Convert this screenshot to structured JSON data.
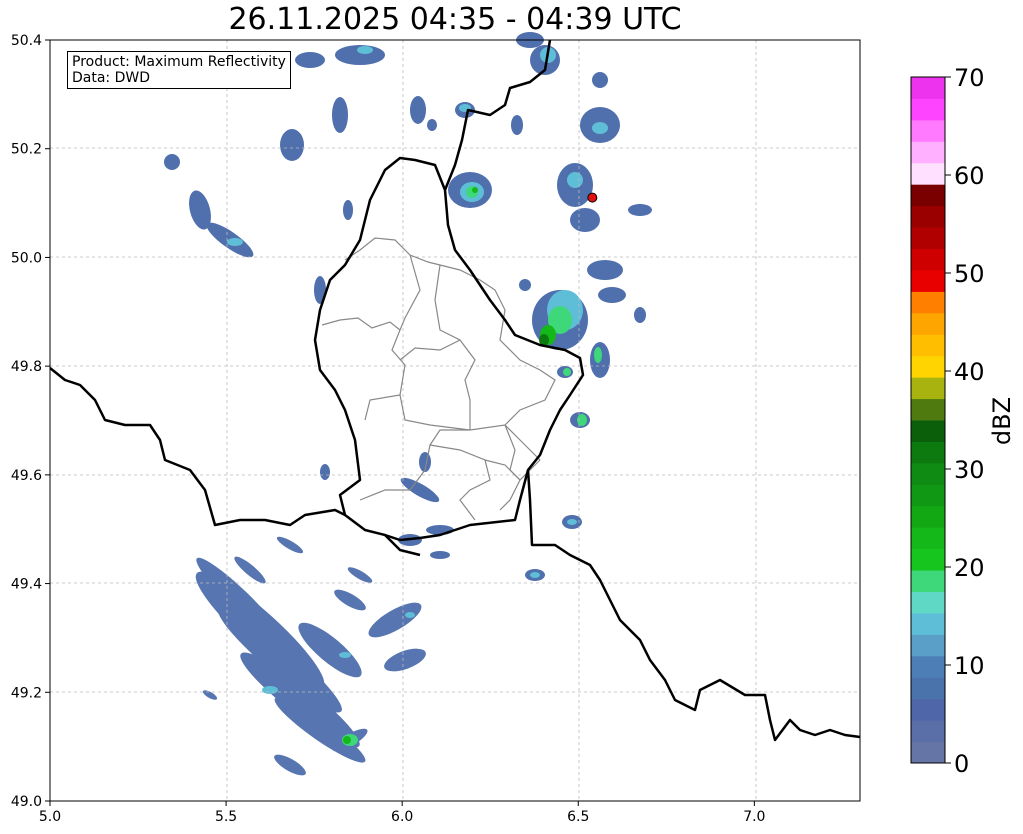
{
  "title": "26.11.2025 04:35 - 04:39 UTC",
  "info_box": {
    "product": "Product: Maximum Reflectivity",
    "data": "Data: DWD"
  },
  "map": {
    "lon_range": [
      5.0,
      7.3
    ],
    "lat_range": [
      49.0,
      50.4
    ],
    "x_ticks": [
      "5.0",
      "5.5",
      "6.0",
      "6.5",
      "7.0"
    ],
    "y_ticks": [
      "49.0",
      "49.2",
      "49.4",
      "49.6",
      "49.8",
      "50.0",
      "50.2",
      "50.4"
    ],
    "grid": true,
    "marker": {
      "lon": 6.54,
      "lat": 50.11,
      "color": "#e01010"
    }
  },
  "colorbar": {
    "label": "dBZ",
    "ticks": [
      "0",
      "10",
      "20",
      "30",
      "40",
      "50",
      "60",
      "70"
    ],
    "colors": [
      "#6475a6",
      "#5a6ea8",
      "#4f66a8",
      "#4a72ab",
      "#4d7eb6",
      "#5a9fc8",
      "#5fbed7",
      "#5fd8c6",
      "#3ed87a",
      "#16c61e",
      "#14b818",
      "#12a814",
      "#109814",
      "#0f8a12",
      "#0d7a10",
      "#0b5f0b",
      "#4e7a10",
      "#a9b30f",
      "#ffd400",
      "#ffbf00",
      "#ffa500",
      "#ff8000",
      "#e80000",
      "#cf0000",
      "#b00000",
      "#9a0000",
      "#7a0000",
      "#ffe0ff",
      "#ffb0ff",
      "#ff7aff",
      "#ff44ff",
      "#ee33ee"
    ]
  }
}
